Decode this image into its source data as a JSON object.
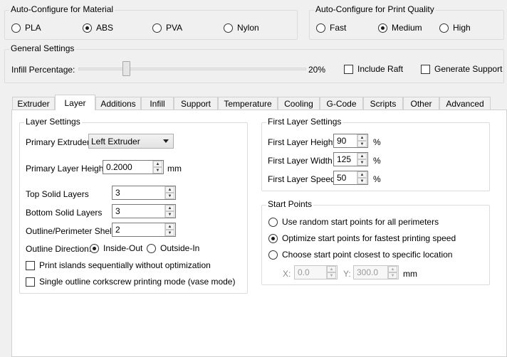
{
  "material": {
    "title": "Auto-Configure for Material",
    "options": [
      "PLA",
      "ABS",
      "PVA",
      "Nylon"
    ],
    "selected": "ABS"
  },
  "quality": {
    "title": "Auto-Configure for Print Quality",
    "options": [
      "Fast",
      "Medium",
      "High"
    ],
    "selected": "Medium"
  },
  "general": {
    "title": "General Settings",
    "infill_label": "Infill Percentage:",
    "infill_value": "20%",
    "infill_fraction": 0.2,
    "include_raft": "Include Raft",
    "generate_support": "Generate Support"
  },
  "tabs": [
    "Extruder",
    "Layer",
    "Additions",
    "Infill",
    "Support",
    "Temperature",
    "Cooling",
    "G-Code",
    "Scripts",
    "Other",
    "Advanced"
  ],
  "active_tab": "Layer",
  "layer_settings": {
    "title": "Layer Settings",
    "primary_extruder_label": "Primary Extruder",
    "primary_extruder_value": "Left Extruder",
    "primary_layer_height_label": "Primary Layer Height",
    "primary_layer_height_value": "0.2000",
    "primary_layer_height_unit": "mm",
    "top_solid_layers_label": "Top Solid Layers",
    "top_solid_layers_value": "3",
    "bottom_solid_layers_label": "Bottom Solid Layers",
    "bottom_solid_layers_value": "3",
    "outline_shells_label": "Outline/Perimeter Shells",
    "outline_shells_value": "2",
    "outline_direction_label": "Outline Direction:",
    "outline_direction_options": [
      "Inside-Out",
      "Outside-In"
    ],
    "outline_direction_selected": "Inside-Out",
    "print_islands": "Print islands sequentially without optimization",
    "vase_mode": "Single outline corkscrew printing mode (vase mode)"
  },
  "first_layer": {
    "title": "First Layer Settings",
    "height_label": "First Layer Height",
    "height_value": "90",
    "width_label": "First Layer Width",
    "width_value": "125",
    "speed_label": "First Layer Speed",
    "speed_value": "50",
    "unit": "%"
  },
  "start_points": {
    "title": "Start Points",
    "options": [
      "Use random start points for all perimeters",
      "Optimize start points for fastest printing speed",
      "Choose start point closest to specific location"
    ],
    "selected": "Optimize start points for fastest printing speed",
    "x_label": "X:",
    "x_value": "0.0",
    "y_label": "Y:",
    "y_value": "300.0",
    "unit": "mm"
  }
}
